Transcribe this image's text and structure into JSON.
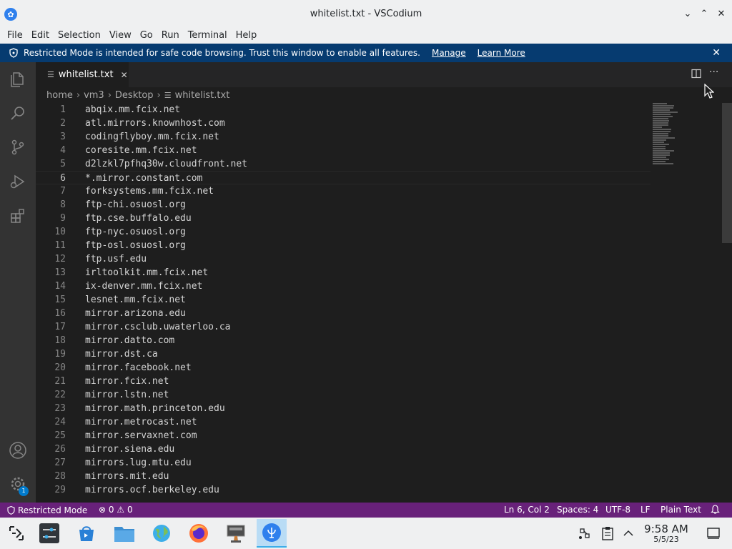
{
  "window": {
    "title": "whitelist.txt - VSCodium"
  },
  "menu": [
    "File",
    "Edit",
    "Selection",
    "View",
    "Go",
    "Run",
    "Terminal",
    "Help"
  ],
  "banner": {
    "message": "Restricted Mode is intended for safe code browsing. Trust this window to enable all features.",
    "manage": "Manage",
    "learn_more": "Learn More"
  },
  "tab": {
    "label": "whitelist.txt"
  },
  "breadcrumb": [
    "home",
    "vm3",
    "Desktop",
    "whitelist.txt"
  ],
  "editor": {
    "current_line": 6,
    "lines": [
      "abqix.mm.fcix.net",
      "atl.mirrors.knownhost.com",
      "codingflyboy.mm.fcix.net",
      "coresite.mm.fcix.net",
      "d2lzkl7pfhq30w.cloudfront.net",
      "*.mirror.constant.com",
      "forksystems.mm.fcix.net",
      "ftp-chi.osuosl.org",
      "ftp.cse.buffalo.edu",
      "ftp-nyc.osuosl.org",
      "ftp-osl.osuosl.org",
      "ftp.usf.edu",
      "irltoolkit.mm.fcix.net",
      "ix-denver.mm.fcix.net",
      "lesnet.mm.fcix.net",
      "mirror.arizona.edu",
      "mirror.csclub.uwaterloo.ca",
      "mirror.datto.com",
      "mirror.dst.ca",
      "mirror.facebook.net",
      "mirror.fcix.net",
      "mirror.lstn.net",
      "mirror.math.princeton.edu",
      "mirror.metrocast.net",
      "mirror.servaxnet.com",
      "mirror.siena.edu",
      "mirrors.lug.mtu.edu",
      "mirrors.mit.edu",
      "mirrors.ocf.berkeley.edu"
    ]
  },
  "status": {
    "restricted": "Restricted Mode",
    "errors": "0",
    "warnings": "0",
    "position": "Ln 6, Col 2",
    "spaces": "Spaces: 4",
    "encoding": "UTF-8",
    "eol": "LF",
    "language": "Plain Text"
  },
  "activity_badge": "1",
  "clock": {
    "time": "9:58 AM",
    "date": "5/5/23"
  },
  "colors": {
    "status_bar": "#68217a",
    "banner": "#063b70",
    "accent": "#007acc"
  }
}
